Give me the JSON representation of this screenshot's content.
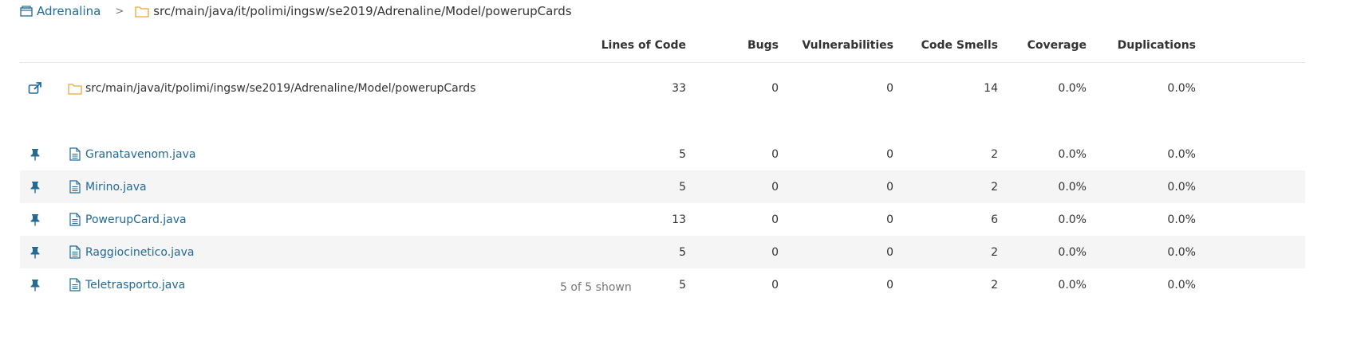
{
  "breadcrumb": {
    "project": "Adrenalina",
    "separator": ">",
    "path": "src/main/java/it/polimi/ingsw/se2019/Adrenaline/Model/powerupCards"
  },
  "columns": {
    "lines_of_code": "Lines of Code",
    "bugs": "Bugs",
    "vulnerabilities": "Vulnerabilities",
    "code_smells": "Code Smells",
    "coverage": "Coverage",
    "duplications": "Duplications"
  },
  "directory": {
    "name": "src/main/java/it/polimi/ingsw/se2019/Adrenaline/Model/powerupCards",
    "lines_of_code": "33",
    "bugs": "0",
    "vulnerabilities": "0",
    "code_smells": "14",
    "coverage": "0.0%",
    "duplications": "0.0%"
  },
  "files": [
    {
      "name": "Granatavenom.java",
      "lines_of_code": "5",
      "bugs": "0",
      "vulnerabilities": "0",
      "code_smells": "2",
      "coverage": "0.0%",
      "duplications": "0.0%"
    },
    {
      "name": "Mirino.java",
      "lines_of_code": "5",
      "bugs": "0",
      "vulnerabilities": "0",
      "code_smells": "2",
      "coverage": "0.0%",
      "duplications": "0.0%"
    },
    {
      "name": "PowerupCard.java",
      "lines_of_code": "13",
      "bugs": "0",
      "vulnerabilities": "0",
      "code_smells": "6",
      "coverage": "0.0%",
      "duplications": "0.0%"
    },
    {
      "name": "Raggiocinetico.java",
      "lines_of_code": "5",
      "bugs": "0",
      "vulnerabilities": "0",
      "code_smells": "2",
      "coverage": "0.0%",
      "duplications": "0.0%"
    },
    {
      "name": "Teletrasporto.java",
      "lines_of_code": "5",
      "bugs": "0",
      "vulnerabilities": "0",
      "code_smells": "2",
      "coverage": "0.0%",
      "duplications": "0.0%"
    }
  ],
  "footer": {
    "shown": "5 of 5 shown"
  },
  "colors": {
    "link": "#236a97",
    "folder": "#f0a43a",
    "alt_row": "#f5f5f5"
  }
}
